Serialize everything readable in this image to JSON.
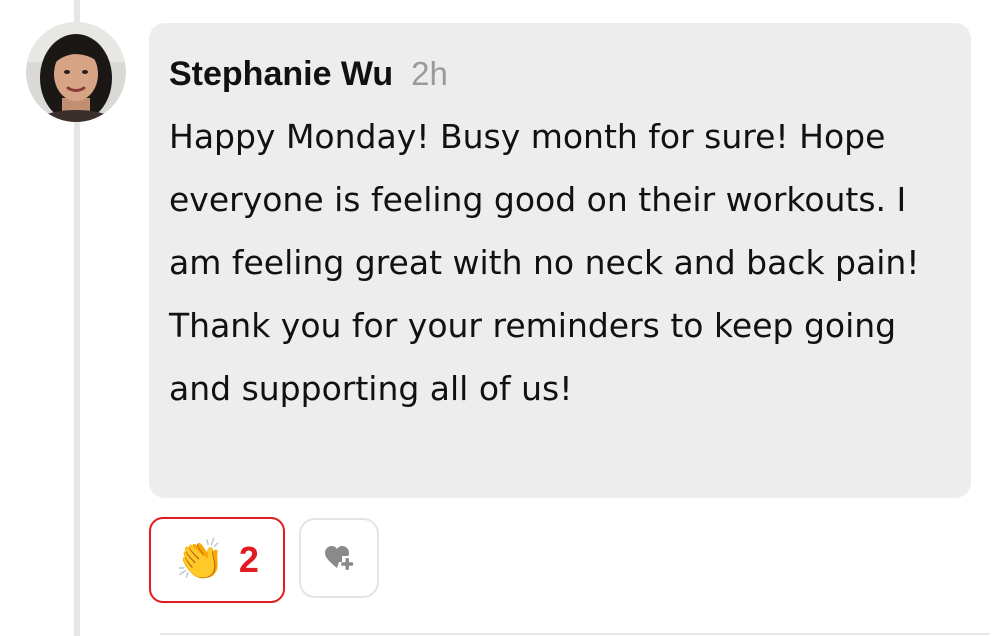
{
  "comment": {
    "author": "Stephanie Wu",
    "timestamp": "2h",
    "message": "Happy Monday! Busy month for sure! Hope everyone is feeling good on their workouts. I am feeling great with no neck and back pain! Thank you for your reminders to keep going and supporting all of us!"
  },
  "reactions": [
    {
      "emoji": "👏",
      "icon": "clapping-hands-icon",
      "count": "2",
      "active": true
    }
  ],
  "add_reaction": {
    "icon": "heart-plus-icon"
  },
  "colors": {
    "accent": "#e21b23",
    "bubble": "#ededed",
    "timestamp": "#9a9a9a",
    "text": "#111111"
  }
}
